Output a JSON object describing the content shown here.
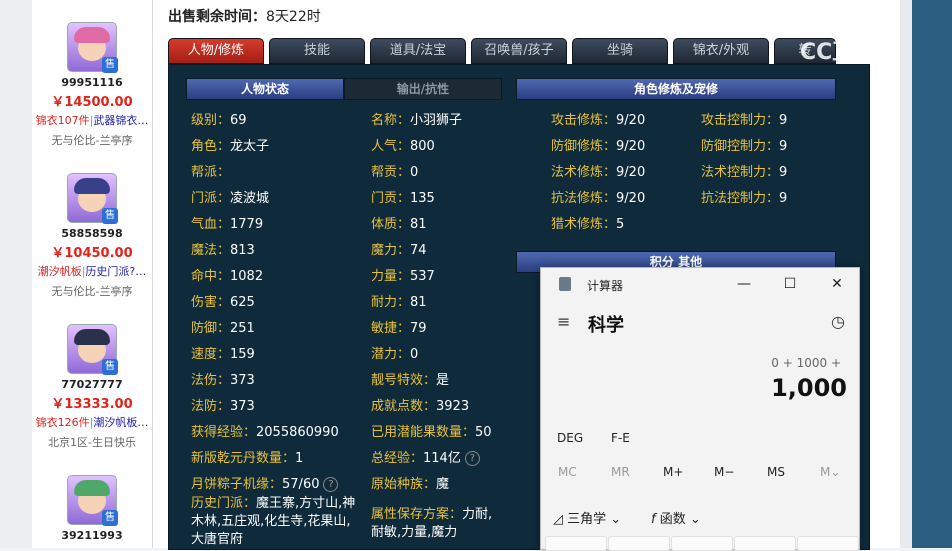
{
  "sidebar": {
    "cards": [
      {
        "id": "99951116",
        "price": "￥14500.00",
        "tag1": "锦衣107件",
        "tag2": "武器锦衣…",
        "server": "无与伦比-兰亭序",
        "hair": "#e06aa6"
      },
      {
        "id": "58858598",
        "price": "￥10450.00",
        "tag1": "潮汐帆板",
        "tag2": "历史门派?…",
        "server": "无与伦比-兰亭序",
        "hair": "#3a3f8a"
      },
      {
        "id": "77027777",
        "price": "￥13333.00",
        "tag1": "锦衣126件",
        "tag2": "潮汐帆板…",
        "server": "北京1区-生日快乐",
        "hair": "#2a2f4a"
      },
      {
        "id": "39211993",
        "price": "",
        "tag1": "",
        "tag2": "",
        "server": "",
        "hair": "#4fa86a"
      }
    ],
    "sale_badge": "售"
  },
  "header": {
    "sale_time_label": "出售剩余时间：",
    "sale_time_value": "8天22时"
  },
  "tabs": [
    "人物/修炼",
    "技能",
    "道具/法宝",
    "召唤兽/孩子",
    "坐骑",
    "锦衣/外观",
    "转"
  ],
  "sections": {
    "char_status": "人物状态",
    "output_resist": "输出/抗性",
    "cultivation": "角色修炼及宠修",
    "points_other": "积分  其他"
  },
  "col1": [
    {
      "k": "级别：",
      "v": "69"
    },
    {
      "k": "角色：",
      "v": "龙太子"
    },
    {
      "k": "帮派：",
      "v": ""
    },
    {
      "k": "门派：",
      "v": "凌波城"
    },
    {
      "k": "气血：",
      "v": "1779"
    },
    {
      "k": "魔法：",
      "v": "813"
    },
    {
      "k": "命中：",
      "v": "1082"
    },
    {
      "k": "伤害：",
      "v": "625"
    },
    {
      "k": "防御：",
      "v": "251"
    },
    {
      "k": "速度：",
      "v": "159"
    },
    {
      "k": "法伤：",
      "v": "373"
    },
    {
      "k": "法防：",
      "v": "373"
    },
    {
      "k": "获得经验：",
      "v": "2055860990"
    },
    {
      "k": "新版乾元丹数量：",
      "v": "1"
    },
    {
      "k": "月饼粽子机缘：",
      "v": "57/60"
    }
  ],
  "col1_history": {
    "k": "历史门派：",
    "v": "魔王寨,方寸山,神木林,五庄观,化生寺,花果山,大唐官府"
  },
  "col2": [
    {
      "k": "名称：",
      "v": "小羽狮子"
    },
    {
      "k": "人气：",
      "v": "800"
    },
    {
      "k": "帮贡：",
      "v": "0"
    },
    {
      "k": "门贡：",
      "v": "135"
    },
    {
      "k": "体质：",
      "v": "81"
    },
    {
      "k": "魔力：",
      "v": "74"
    },
    {
      "k": "力量：",
      "v": "537"
    },
    {
      "k": "耐力：",
      "v": "81"
    },
    {
      "k": "敏捷：",
      "v": "79"
    },
    {
      "k": "潜力：",
      "v": "0"
    },
    {
      "k": "靓号特效：",
      "v": "是"
    },
    {
      "k": "成就点数：",
      "v": "3923"
    },
    {
      "k": "已用潜能果数量：",
      "v": "50"
    },
    {
      "k": "总经验：",
      "v": "114亿"
    },
    {
      "k": "原始种族：",
      "v": "魔"
    }
  ],
  "col2_plan": {
    "k": "属性保存方案：",
    "v": "力耐,耐敏,力量,魔力"
  },
  "col3": [
    {
      "k": "攻击修炼：",
      "v": "9/20"
    },
    {
      "k": "防御修炼：",
      "v": "9/20"
    },
    {
      "k": "法术修炼：",
      "v": "9/20"
    },
    {
      "k": "抗法修炼：",
      "v": "9/20"
    },
    {
      "k": "猎术修炼：",
      "v": "5"
    }
  ],
  "col4": [
    {
      "k": "攻击控制力：",
      "v": "9"
    },
    {
      "k": "防御控制力：",
      "v": "9"
    },
    {
      "k": "法术控制力：",
      "v": "9"
    },
    {
      "k": "抗法控制力：",
      "v": "9"
    }
  ],
  "help_icon": "?",
  "watermark": "CC直播",
  "calculator": {
    "title": "计算器",
    "mode": "科学",
    "expression": "0 + 1000 +",
    "display": "1,000",
    "row1": [
      "DEG",
      "F-E"
    ],
    "memory": [
      "MC",
      "MR",
      "M+",
      "M−",
      "MS",
      "M⌄"
    ],
    "trig": "三角学",
    "func": "函数",
    "win_min": "—",
    "win_max": "☐",
    "win_close": "✕",
    "menu_icon": "≡",
    "history_icon": "◷"
  }
}
